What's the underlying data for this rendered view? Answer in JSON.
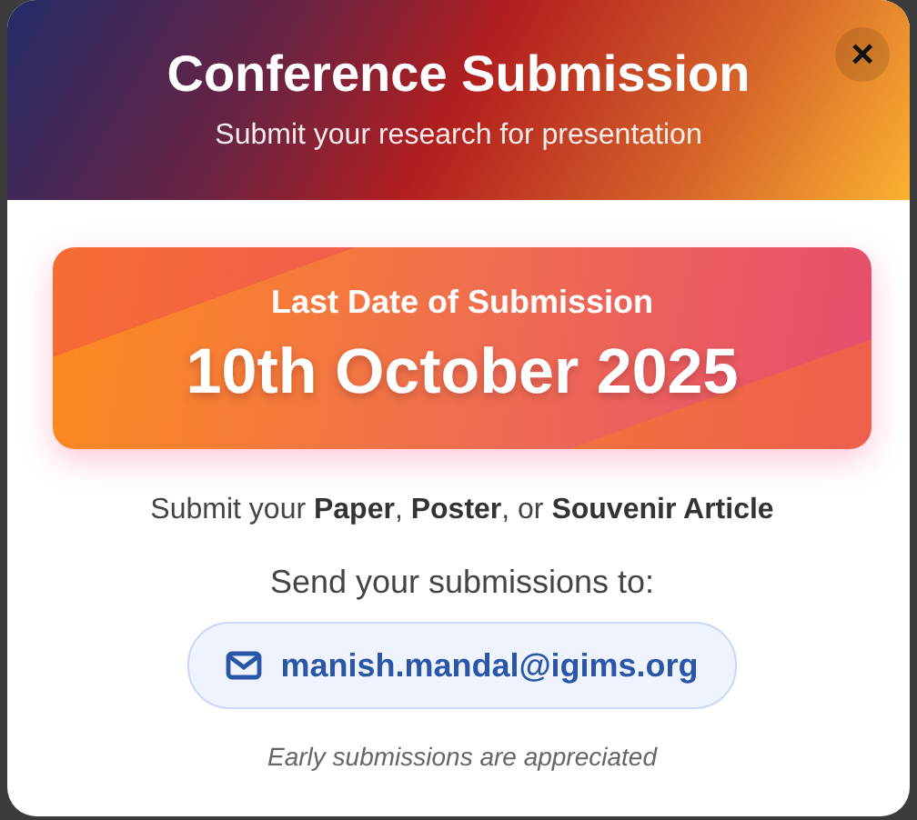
{
  "header": {
    "title": "Conference Submission",
    "subtitle": "Submit your research for presentation",
    "close": "×"
  },
  "deadline": {
    "label": "Last Date of Submission",
    "date": "10th October 2025"
  },
  "types_line": "Submit your **Paper**, **Poster**, or **Souvenir Article**",
  "send_label": "Send your submissions to:",
  "email": "manish.mandal@igims.org",
  "note": "Early submissions are appreciated"
}
